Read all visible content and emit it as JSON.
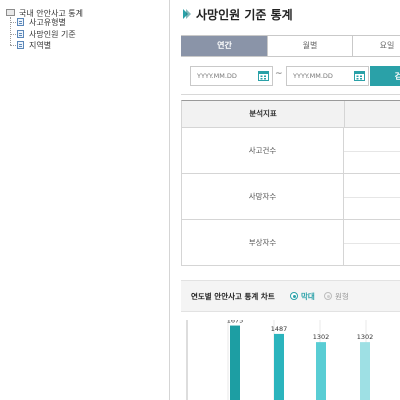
{
  "tree": {
    "root_label": "국내 안안사고 통계",
    "items": [
      {
        "label": "사고유형별"
      },
      {
        "label": "사망인원 기준"
      },
      {
        "label": "지역별"
      }
    ]
  },
  "header": {
    "title": "사망인원 기준 통계"
  },
  "tabs": [
    {
      "label": "연간",
      "active": true
    },
    {
      "label": "월별",
      "active": false
    },
    {
      "label": "요일",
      "active": false
    }
  ],
  "search": {
    "start_placeholder": "YYYY.MM.DD",
    "end_placeholder": "YYYY.MM.DD",
    "separator": "~",
    "button_label": "검색"
  },
  "table": {
    "header_label": "분석지표",
    "rows": [
      {
        "label": "사고건수"
      },
      {
        "label": "사망자수"
      },
      {
        "label": "부상자수"
      }
    ]
  },
  "chart_section": {
    "title": "연도별 안안사고 통계 차트",
    "options": [
      {
        "label": "막대",
        "selected": true
      },
      {
        "label": "원형",
        "selected": false
      }
    ]
  },
  "colors": {
    "accent": "#2aa1a8",
    "tab_active": "#8a94a8"
  },
  "chart_data": {
    "type": "bar",
    "categories": [
      "",
      "",
      "",
      ""
    ],
    "values": [
      1675,
      1487,
      1302,
      1302
    ],
    "colors": [
      "#1d9ea3",
      "#2bb4bd",
      "#59cdd4",
      "#9ee0e4"
    ],
    "ylim": [
      0,
      1800
    ],
    "grid": true,
    "title": "",
    "xlabel": "",
    "ylabel": ""
  }
}
